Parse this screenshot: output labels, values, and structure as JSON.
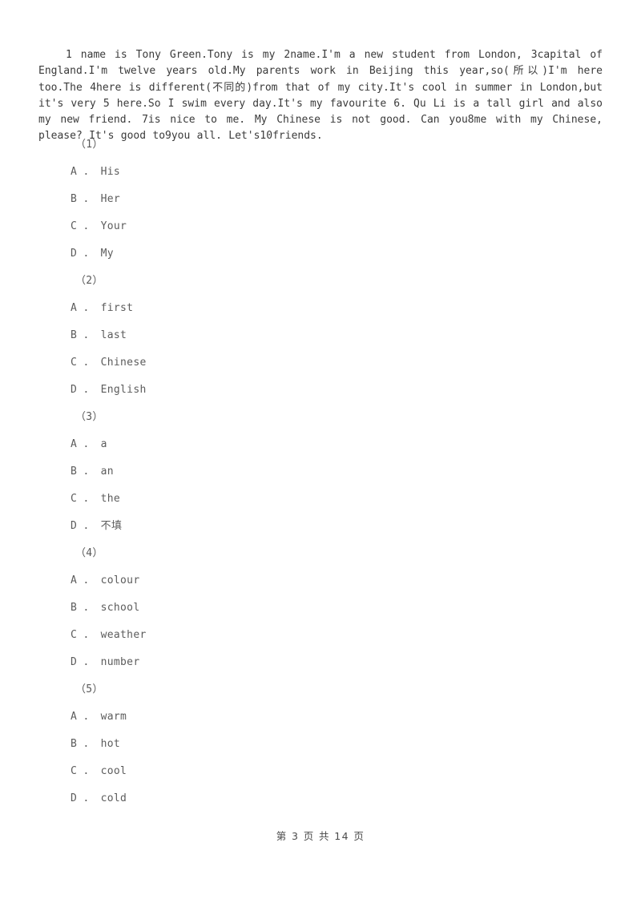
{
  "document": {
    "passage_text": "1 name is Tony Green.Tony is my 2name.I'm a new student from London, 3capital of England.I'm twelve years old.My parents work in Beijing this year,so(所以)I'm here too.The 4here is different(不同的)from that of my city.It's cool in summer in London,but it's very 5 here.So I swim every day.It's my favourite 6. Qu Li is a tall girl and also my new friend. 7is nice to me. My Chinese is not good. Can you8me with my Chinese, please? It's good to9you all. Let's10friends.",
    "questions": [
      {
        "number": "（1）",
        "options": [
          "A ． His",
          "B ． Her",
          "C ． Your",
          "D ． My"
        ]
      },
      {
        "number": "（2）",
        "options": [
          "A ． first",
          "B ． last",
          "C ． Chinese",
          "D ． English"
        ]
      },
      {
        "number": "（3）",
        "options": [
          "A ． a",
          "B ． an",
          "C ． the",
          "D ． 不填"
        ]
      },
      {
        "number": "（4）",
        "options": [
          "A ． colour",
          "B ． school",
          "C ． weather",
          "D ． number"
        ]
      },
      {
        "number": "（5）",
        "options": [
          "A ． warm",
          "B ． hot",
          "C ． cool",
          "D ． cold"
        ]
      }
    ],
    "footer": {
      "page_label": "第 3 页 共 14 页",
      "current_page": "3",
      "total_pages": "14"
    },
    "colors": {
      "background": "#ffffff",
      "passage_text": "#3a3a3a",
      "option_text": "#5c5c5c",
      "footer_text": "#4a4a4a"
    }
  }
}
